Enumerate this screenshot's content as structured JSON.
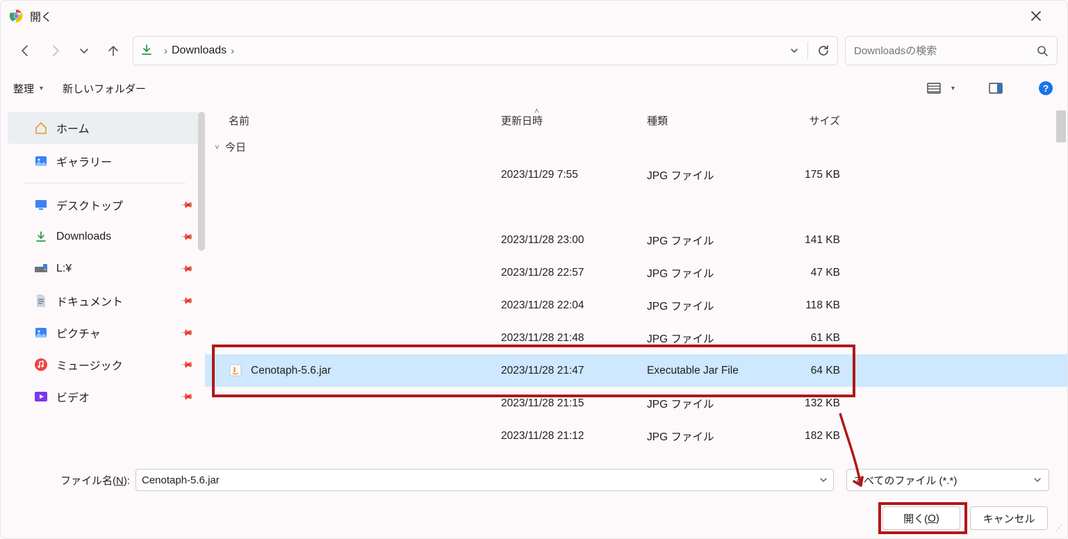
{
  "window": {
    "title": "開く"
  },
  "nav": {
    "location": "Downloads",
    "search_placeholder": "Downloadsの検索"
  },
  "toolbar": {
    "organize": "整理",
    "new_folder": "新しいフォルダー"
  },
  "sidebar": {
    "items": [
      {
        "id": "home",
        "label": "ホーム",
        "selected": true
      },
      {
        "id": "gallery",
        "label": "ギャラリー"
      },
      {
        "id": "desktop",
        "label": "デスクトップ",
        "pinned": true
      },
      {
        "id": "downloads",
        "label": "Downloads",
        "pinned": true
      },
      {
        "id": "ldrive",
        "label": "L:¥",
        "pinned": true
      },
      {
        "id": "documents",
        "label": "ドキュメント",
        "pinned": true
      },
      {
        "id": "pictures",
        "label": "ピクチャ",
        "pinned": true
      },
      {
        "id": "music",
        "label": "ミュージック",
        "pinned": true
      },
      {
        "id": "videos",
        "label": "ビデオ",
        "pinned": true
      }
    ]
  },
  "columns": {
    "name": "名前",
    "date": "更新日時",
    "type": "種類",
    "size": "サイズ"
  },
  "group_label": "今日",
  "files": [
    {
      "name": "",
      "date": "2023/11/29 7:55",
      "type": "JPG ファイル",
      "size": "175 KB",
      "blurred": true
    },
    {
      "name": "",
      "date": "",
      "type": "",
      "size": "",
      "blurred": true,
      "short": true
    },
    {
      "name": "",
      "date": "2023/11/28 23:00",
      "type": "JPG ファイル",
      "size": "141 KB",
      "blurred": true
    },
    {
      "name": "",
      "date": "2023/11/28 22:57",
      "type": "JPG ファイル",
      "size": "47 KB",
      "blurred": true
    },
    {
      "name": "",
      "date": "2023/11/28 22:04",
      "type": "JPG ファイル",
      "size": "118 KB",
      "blurred": true
    },
    {
      "name": "",
      "date": "2023/11/28 21:48",
      "type": "JPG ファイル",
      "size": "61 KB",
      "blurred": true
    },
    {
      "name": "Cenotaph-5.6.jar",
      "date": "2023/11/28 21:47",
      "type": "Executable Jar File",
      "size": "64 KB",
      "selected": true,
      "icon": "jar"
    },
    {
      "name": "",
      "date": "2023/11/28 21:15",
      "type": "JPG ファイル",
      "size": "132 KB",
      "blurred": true
    },
    {
      "name": "",
      "date": "2023/11/28 21:12",
      "type": "JPG ファイル",
      "size": "182 KB",
      "blurred": true
    }
  ],
  "footer": {
    "filename_label_pre": "ファイル名(",
    "filename_label_key": "N",
    "filename_label_post": "):",
    "filename_value": "Cenotaph-5.6.jar",
    "filter_value": "すべてのファイル (*.*)",
    "open_label_pre": "開く(",
    "open_label_key": "O",
    "open_label_post": ")",
    "cancel_label": "キャンセル"
  }
}
